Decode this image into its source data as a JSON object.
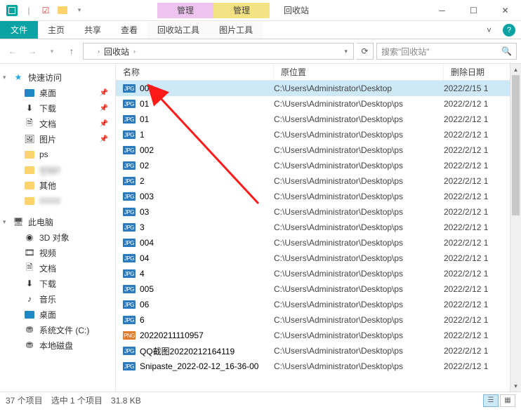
{
  "window": {
    "title": "回收站",
    "context_tabs": [
      {
        "label": "管理",
        "cls": "ctx-pink"
      },
      {
        "label": "管理",
        "cls": "ctx-yellow"
      }
    ]
  },
  "ribbon": {
    "file": "文件",
    "tabs": [
      "主页",
      "共享",
      "查看",
      "回收站工具",
      "图片工具"
    ]
  },
  "address": {
    "root_icon": "recycle-bin",
    "segments": [
      "回收站"
    ]
  },
  "search": {
    "placeholder": "搜索\"回收站\""
  },
  "nav": {
    "quick_access": "快速访问",
    "items_qa": [
      {
        "label": "桌面",
        "icon": "desktop",
        "pinned": true
      },
      {
        "label": "下载",
        "icon": "download",
        "pinned": true
      },
      {
        "label": "文档",
        "icon": "doc",
        "pinned": true
      },
      {
        "label": "图片",
        "icon": "pic",
        "pinned": true
      },
      {
        "label": "ps",
        "icon": "folder",
        "pinned": false
      },
      {
        "label": "工作记",
        "icon": "folder",
        "pinned": false,
        "blurred": true
      },
      {
        "label": "其他",
        "icon": "folder",
        "pinned": false
      },
      {
        "label": "",
        "icon": "folder",
        "pinned": false,
        "blurred": true
      }
    ],
    "this_pc": "此电脑",
    "items_pc": [
      {
        "label": "3D 对象",
        "icon": "3d"
      },
      {
        "label": "视频",
        "icon": "video"
      },
      {
        "label": "文档",
        "icon": "doc"
      },
      {
        "label": "下载",
        "icon": "download"
      },
      {
        "label": "音乐",
        "icon": "music"
      },
      {
        "label": "桌面",
        "icon": "desktop"
      },
      {
        "label": "系统文件 (C:)",
        "icon": "drive"
      },
      {
        "label": "本地磁盘",
        "icon": "drive"
      }
    ]
  },
  "columns": {
    "name": "名称",
    "loc": "原位置",
    "date": "删除日期"
  },
  "rows": [
    {
      "name": "001",
      "type": "JPG",
      "loc": "C:\\Users\\Administrator\\Desktop",
      "date": "2022/2/15 1",
      "selected": true
    },
    {
      "name": "01",
      "type": "JPG",
      "loc": "C:\\Users\\Administrator\\Desktop\\ps",
      "date": "2022/2/12 1"
    },
    {
      "name": "01",
      "type": "JPG",
      "loc": "C:\\Users\\Administrator\\Desktop\\ps",
      "date": "2022/2/12 1"
    },
    {
      "name": "1",
      "type": "JPG",
      "loc": "C:\\Users\\Administrator\\Desktop\\ps",
      "date": "2022/2/12 1"
    },
    {
      "name": "002",
      "type": "JPG",
      "loc": "C:\\Users\\Administrator\\Desktop\\ps",
      "date": "2022/2/12 1"
    },
    {
      "name": "02",
      "type": "JPG",
      "loc": "C:\\Users\\Administrator\\Desktop\\ps",
      "date": "2022/2/12 1"
    },
    {
      "name": "2",
      "type": "JPG",
      "loc": "C:\\Users\\Administrator\\Desktop\\ps",
      "date": "2022/2/12 1"
    },
    {
      "name": "003",
      "type": "JPG",
      "loc": "C:\\Users\\Administrator\\Desktop\\ps",
      "date": "2022/2/12 1"
    },
    {
      "name": "03",
      "type": "JPG",
      "loc": "C:\\Users\\Administrator\\Desktop\\ps",
      "date": "2022/2/12 1"
    },
    {
      "name": "3",
      "type": "JPG",
      "loc": "C:\\Users\\Administrator\\Desktop\\ps",
      "date": "2022/2/12 1"
    },
    {
      "name": "004",
      "type": "JPG",
      "loc": "C:\\Users\\Administrator\\Desktop\\ps",
      "date": "2022/2/12 1"
    },
    {
      "name": "04",
      "type": "JPG",
      "loc": "C:\\Users\\Administrator\\Desktop\\ps",
      "date": "2022/2/12 1"
    },
    {
      "name": "4",
      "type": "JPG",
      "loc": "C:\\Users\\Administrator\\Desktop\\ps",
      "date": "2022/2/12 1"
    },
    {
      "name": "005",
      "type": "JPG",
      "loc": "C:\\Users\\Administrator\\Desktop\\ps",
      "date": "2022/2/12 1"
    },
    {
      "name": "06",
      "type": "JPG",
      "loc": "C:\\Users\\Administrator\\Desktop\\ps",
      "date": "2022/2/12 1"
    },
    {
      "name": "6",
      "type": "JPG",
      "loc": "C:\\Users\\Administrator\\Desktop\\ps",
      "date": "2022/2/12 1"
    },
    {
      "name": "20220211110957",
      "type": "PNG",
      "loc": "C:\\Users\\Administrator\\Desktop\\ps",
      "date": "2022/2/12 1"
    },
    {
      "name": "QQ截图20220212164119",
      "type": "JPG",
      "loc": "C:\\Users\\Administrator\\Desktop\\ps",
      "date": "2022/2/12 1"
    },
    {
      "name": "Snipaste_2022-02-12_16-36-00",
      "type": "JPG",
      "loc": "C:\\Users\\Administrator\\Desktop\\ps",
      "date": "2022/2/12 1"
    }
  ],
  "status": {
    "count": "37 个项目",
    "selected": "选中 1 个项目",
    "size": "31.8 KB"
  }
}
